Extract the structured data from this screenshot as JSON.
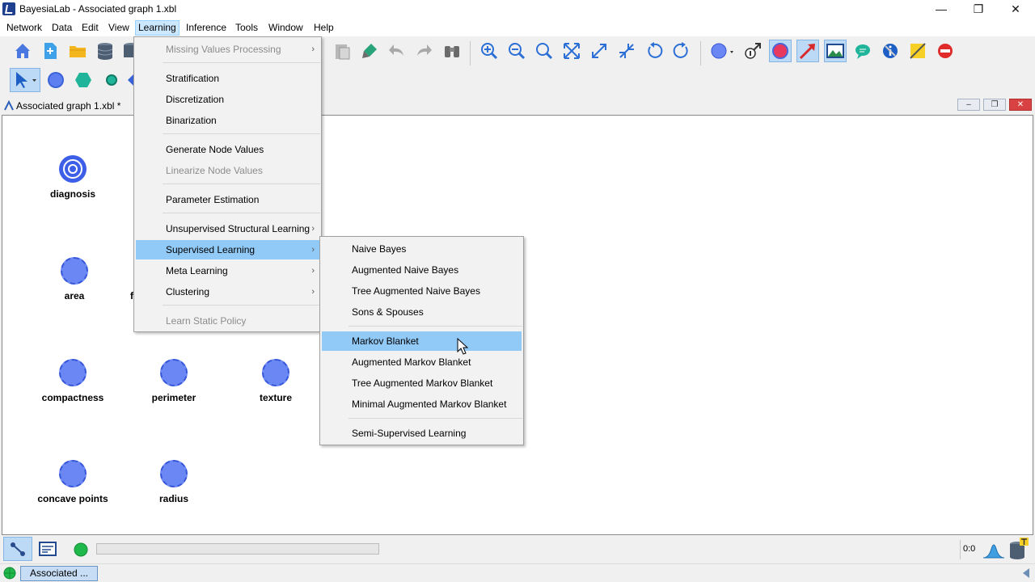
{
  "window": {
    "title": "BayesiaLab - Associated graph 1.xbl",
    "minimize": "—",
    "maximize": "❐",
    "close": "✕"
  },
  "menubar": [
    "Network",
    "Data",
    "Edit",
    "View",
    "Learning",
    "Inference",
    "Tools",
    "Window",
    "Help"
  ],
  "document": {
    "title": "Associated graph 1.xbl *",
    "min": "–",
    "restore": "❐",
    "close": "✕"
  },
  "nodes": [
    {
      "label": "diagnosis",
      "type": "target"
    },
    {
      "label": "area",
      "type": "node"
    },
    {
      "label": "f",
      "type": "node"
    },
    {
      "label": "compactness",
      "type": "node"
    },
    {
      "label": "perimeter",
      "type": "node"
    },
    {
      "label": "texture",
      "type": "node"
    },
    {
      "label": "concave points",
      "type": "node"
    },
    {
      "label": "radius",
      "type": "node"
    }
  ],
  "learning_menu": [
    {
      "label": "Missing Values Processing",
      "disabled": true,
      "submenu": true
    },
    {
      "label": "Stratification"
    },
    {
      "label": "Discretization"
    },
    {
      "label": "Binarization"
    },
    {
      "label": "Generate Node Values"
    },
    {
      "label": "Linearize Node Values",
      "disabled": true
    },
    {
      "label": "Parameter Estimation"
    },
    {
      "label": "Unsupervised Structural Learning",
      "submenu": true
    },
    {
      "label": "Supervised Learning",
      "submenu": true,
      "highlighted": true
    },
    {
      "label": "Meta Learning",
      "submenu": true
    },
    {
      "label": "Clustering",
      "submenu": true
    },
    {
      "label": "Learn Static Policy",
      "disabled": true
    }
  ],
  "supervised_submenu": [
    {
      "label": "Naive Bayes"
    },
    {
      "label": "Augmented Naive Bayes"
    },
    {
      "label": "Tree Augmented Naive Bayes"
    },
    {
      "label": "Sons & Spouses"
    },
    {
      "label": "Markov Blanket",
      "highlighted": true
    },
    {
      "label": "Augmented Markov Blanket"
    },
    {
      "label": "Tree Augmented Markov Blanket"
    },
    {
      "label": "Minimal Augmented Markov Blanket"
    },
    {
      "label": "Semi-Supervised Learning"
    }
  ],
  "submenu_arrow": "›",
  "status": {
    "zoom": "0:0",
    "task_tab": "Associated ..."
  },
  "colors": {
    "node_fill": "#6b87f3",
    "menu_highlight": "#91c9f7",
    "open_menu": "#cce8ff"
  }
}
